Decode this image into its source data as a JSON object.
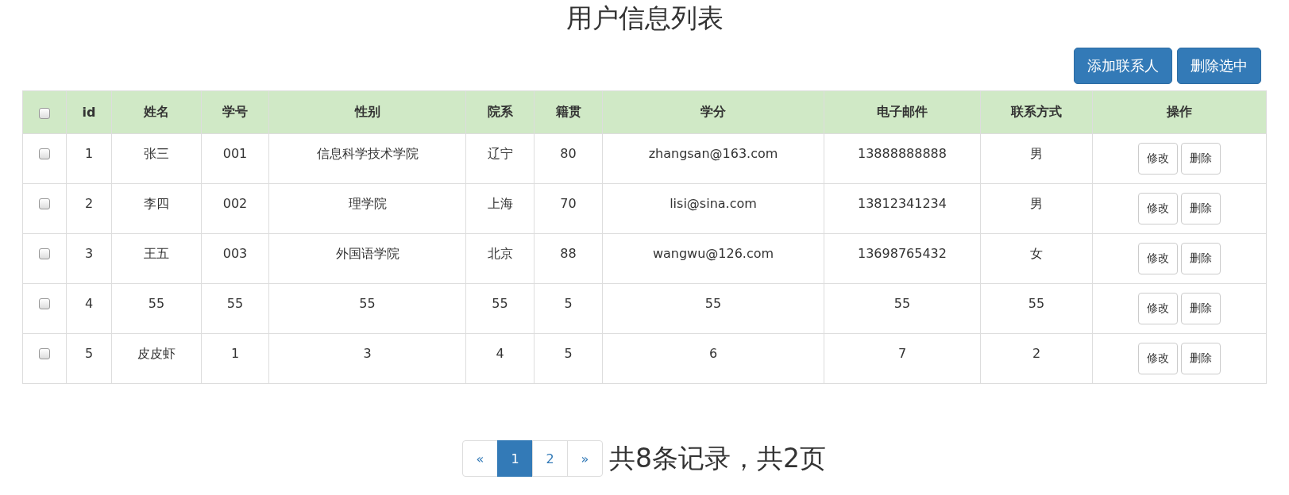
{
  "title": "用户信息列表",
  "toolbar": {
    "buttons": [
      "添加联系人",
      "删除选中"
    ]
  },
  "table": {
    "select_all": {
      "checked": false
    },
    "columns": [
      "id",
      "姓名",
      "学号",
      "性别",
      "院系",
      "籍贯",
      "学分",
      "电子邮件",
      "联系方式",
      "操作"
    ],
    "rows": [
      {
        "checked": false,
        "cells": [
          "1",
          "张三",
          "001",
          "信息科学技术学院",
          "辽宁",
          "80",
          "zhangsan@163.com",
          "13888888888",
          "男"
        ],
        "actions": [
          "修改",
          "删除"
        ]
      },
      {
        "checked": false,
        "cells": [
          "2",
          "李四",
          "002",
          "理学院",
          "上海",
          "70",
          "lisi@sina.com",
          "13812341234",
          "男"
        ],
        "actions": [
          "修改",
          "删除"
        ]
      },
      {
        "checked": false,
        "cells": [
          "3",
          "王五",
          "003",
          "外国语学院",
          "北京",
          "88",
          "wangwu@126.com",
          "13698765432",
          "女"
        ],
        "actions": [
          "修改",
          "删除"
        ]
      },
      {
        "checked": false,
        "cells": [
          "4",
          "55",
          "55",
          "55",
          "55",
          "5",
          "55",
          "55",
          "55"
        ],
        "actions": [
          "修改",
          "删除"
        ]
      },
      {
        "checked": false,
        "cells": [
          "5",
          "皮皮虾",
          "1",
          "3",
          "4",
          "5",
          "6",
          "7",
          "2"
        ],
        "actions": [
          "修改",
          "删除"
        ]
      }
    ]
  },
  "pagination": {
    "items": [
      {
        "label": "«",
        "kind": "prev",
        "selected": false
      },
      {
        "label": "1",
        "kind": "page",
        "selected": true
      },
      {
        "label": "2",
        "kind": "page",
        "selected": false
      },
      {
        "label": "»",
        "kind": "next",
        "selected": false
      }
    ],
    "summary": "共8条记录，共2页"
  }
}
